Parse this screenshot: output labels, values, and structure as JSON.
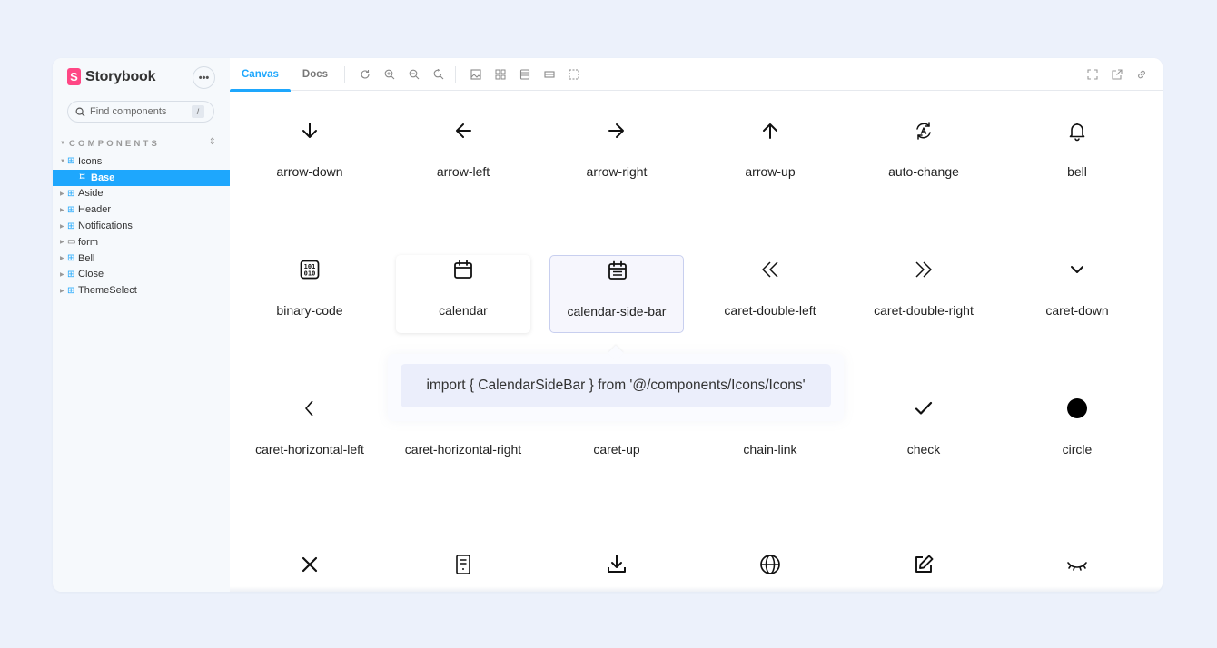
{
  "sidebar": {
    "brand": "Storybook",
    "menu_label": "•••",
    "search_placeholder": "Find components",
    "search_shortcut": "/",
    "section_title": "COMPONENTS",
    "items": [
      {
        "label": "Icons",
        "kind": "component",
        "expanded": true
      },
      {
        "label": "Base",
        "kind": "story",
        "selected": true
      },
      {
        "label": "Aside",
        "kind": "component"
      },
      {
        "label": "Header",
        "kind": "component"
      },
      {
        "label": "Notifications",
        "kind": "component"
      },
      {
        "label": "form",
        "kind": "folder"
      },
      {
        "label": "Bell",
        "kind": "component"
      },
      {
        "label": "Close",
        "kind": "component"
      },
      {
        "label": "ThemeSelect",
        "kind": "component"
      }
    ]
  },
  "toolbar": {
    "tabs": [
      {
        "label": "Canvas",
        "active": true
      },
      {
        "label": "Docs",
        "active": false
      }
    ],
    "tools": [
      "refresh-icon",
      "zoom-in-icon",
      "zoom-out-icon",
      "zoom-reset-icon",
      "background-icon",
      "grid-icon",
      "viewport-icon",
      "measure-icon",
      "outline-icon"
    ],
    "right_tools": [
      "fullscreen-icon",
      "open-new-tab-icon",
      "copy-link-icon"
    ]
  },
  "icons": [
    {
      "name": "arrow-down",
      "icon": "arrow-down-icon"
    },
    {
      "name": "arrow-left",
      "icon": "arrow-left-icon"
    },
    {
      "name": "arrow-right",
      "icon": "arrow-right-icon"
    },
    {
      "name": "arrow-up",
      "icon": "arrow-up-icon"
    },
    {
      "name": "auto-change",
      "icon": "auto-change-icon"
    },
    {
      "name": "bell",
      "icon": "bell-icon"
    },
    {
      "name": "binary-code",
      "icon": "binary-code-icon"
    },
    {
      "name": "calendar",
      "icon": "calendar-icon"
    },
    {
      "name": "calendar-side-bar",
      "icon": "calendar-side-bar-icon"
    },
    {
      "name": "caret-double-left",
      "icon": "caret-double-left-icon"
    },
    {
      "name": "caret-double-right",
      "icon": "caret-double-right-icon"
    },
    {
      "name": "caret-down",
      "icon": "caret-down-icon"
    },
    {
      "name": "caret-horizontal-left",
      "icon": "caret-horizontal-left-icon"
    },
    {
      "name": "caret-horizontal-right",
      "icon": "caret-horizontal-right-icon"
    },
    {
      "name": "caret-up",
      "icon": "caret-up-icon"
    },
    {
      "name": "chain-link",
      "icon": "chain-link-icon"
    },
    {
      "name": "check",
      "icon": "check-icon"
    },
    {
      "name": "circle",
      "icon": "circle-icon"
    },
    {
      "name": "",
      "icon": "close-icon"
    },
    {
      "name": "",
      "icon": "document-icon"
    },
    {
      "name": "",
      "icon": "download-icon"
    },
    {
      "name": "",
      "icon": "globe-icon"
    },
    {
      "name": "",
      "icon": "edit-icon"
    },
    {
      "name": "",
      "icon": "eye-closed-icon"
    }
  ],
  "tooltip": {
    "text": "import { CalendarSideBar } from '@/components/Icons/Icons'"
  },
  "colors": {
    "accent": "#1ea7fd",
    "brand": "#ff4785",
    "background": "#ecf1fb"
  }
}
